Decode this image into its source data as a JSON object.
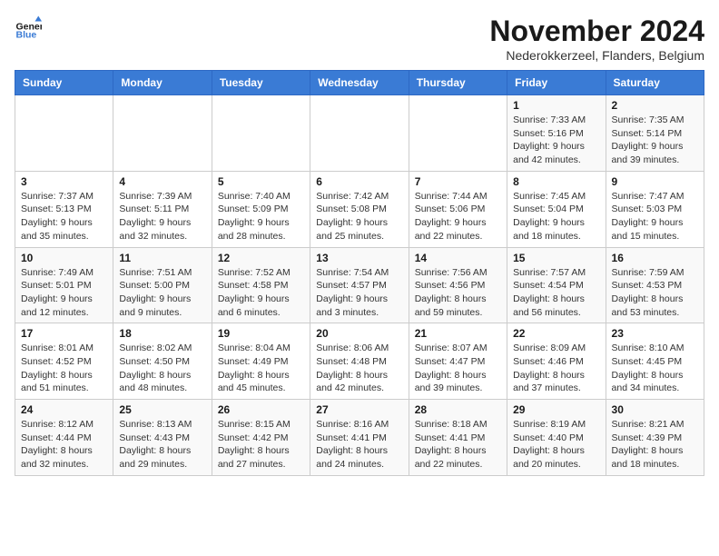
{
  "logo": {
    "text_general": "General",
    "text_blue": "Blue"
  },
  "header": {
    "month_year": "November 2024",
    "location": "Nederokkerzeel, Flanders, Belgium"
  },
  "days_of_week": [
    "Sunday",
    "Monday",
    "Tuesday",
    "Wednesday",
    "Thursday",
    "Friday",
    "Saturday"
  ],
  "weeks": [
    [
      {
        "day": "",
        "info": ""
      },
      {
        "day": "",
        "info": ""
      },
      {
        "day": "",
        "info": ""
      },
      {
        "day": "",
        "info": ""
      },
      {
        "day": "",
        "info": ""
      },
      {
        "day": "1",
        "info": "Sunrise: 7:33 AM\nSunset: 5:16 PM\nDaylight: 9 hours and 42 minutes."
      },
      {
        "day": "2",
        "info": "Sunrise: 7:35 AM\nSunset: 5:14 PM\nDaylight: 9 hours and 39 minutes."
      }
    ],
    [
      {
        "day": "3",
        "info": "Sunrise: 7:37 AM\nSunset: 5:13 PM\nDaylight: 9 hours and 35 minutes."
      },
      {
        "day": "4",
        "info": "Sunrise: 7:39 AM\nSunset: 5:11 PM\nDaylight: 9 hours and 32 minutes."
      },
      {
        "day": "5",
        "info": "Sunrise: 7:40 AM\nSunset: 5:09 PM\nDaylight: 9 hours and 28 minutes."
      },
      {
        "day": "6",
        "info": "Sunrise: 7:42 AM\nSunset: 5:08 PM\nDaylight: 9 hours and 25 minutes."
      },
      {
        "day": "7",
        "info": "Sunrise: 7:44 AM\nSunset: 5:06 PM\nDaylight: 9 hours and 22 minutes."
      },
      {
        "day": "8",
        "info": "Sunrise: 7:45 AM\nSunset: 5:04 PM\nDaylight: 9 hours and 18 minutes."
      },
      {
        "day": "9",
        "info": "Sunrise: 7:47 AM\nSunset: 5:03 PM\nDaylight: 9 hours and 15 minutes."
      }
    ],
    [
      {
        "day": "10",
        "info": "Sunrise: 7:49 AM\nSunset: 5:01 PM\nDaylight: 9 hours and 12 minutes."
      },
      {
        "day": "11",
        "info": "Sunrise: 7:51 AM\nSunset: 5:00 PM\nDaylight: 9 hours and 9 minutes."
      },
      {
        "day": "12",
        "info": "Sunrise: 7:52 AM\nSunset: 4:58 PM\nDaylight: 9 hours and 6 minutes."
      },
      {
        "day": "13",
        "info": "Sunrise: 7:54 AM\nSunset: 4:57 PM\nDaylight: 9 hours and 3 minutes."
      },
      {
        "day": "14",
        "info": "Sunrise: 7:56 AM\nSunset: 4:56 PM\nDaylight: 8 hours and 59 minutes."
      },
      {
        "day": "15",
        "info": "Sunrise: 7:57 AM\nSunset: 4:54 PM\nDaylight: 8 hours and 56 minutes."
      },
      {
        "day": "16",
        "info": "Sunrise: 7:59 AM\nSunset: 4:53 PM\nDaylight: 8 hours and 53 minutes."
      }
    ],
    [
      {
        "day": "17",
        "info": "Sunrise: 8:01 AM\nSunset: 4:52 PM\nDaylight: 8 hours and 51 minutes."
      },
      {
        "day": "18",
        "info": "Sunrise: 8:02 AM\nSunset: 4:50 PM\nDaylight: 8 hours and 48 minutes."
      },
      {
        "day": "19",
        "info": "Sunrise: 8:04 AM\nSunset: 4:49 PM\nDaylight: 8 hours and 45 minutes."
      },
      {
        "day": "20",
        "info": "Sunrise: 8:06 AM\nSunset: 4:48 PM\nDaylight: 8 hours and 42 minutes."
      },
      {
        "day": "21",
        "info": "Sunrise: 8:07 AM\nSunset: 4:47 PM\nDaylight: 8 hours and 39 minutes."
      },
      {
        "day": "22",
        "info": "Sunrise: 8:09 AM\nSunset: 4:46 PM\nDaylight: 8 hours and 37 minutes."
      },
      {
        "day": "23",
        "info": "Sunrise: 8:10 AM\nSunset: 4:45 PM\nDaylight: 8 hours and 34 minutes."
      }
    ],
    [
      {
        "day": "24",
        "info": "Sunrise: 8:12 AM\nSunset: 4:44 PM\nDaylight: 8 hours and 32 minutes."
      },
      {
        "day": "25",
        "info": "Sunrise: 8:13 AM\nSunset: 4:43 PM\nDaylight: 8 hours and 29 minutes."
      },
      {
        "day": "26",
        "info": "Sunrise: 8:15 AM\nSunset: 4:42 PM\nDaylight: 8 hours and 27 minutes."
      },
      {
        "day": "27",
        "info": "Sunrise: 8:16 AM\nSunset: 4:41 PM\nDaylight: 8 hours and 24 minutes."
      },
      {
        "day": "28",
        "info": "Sunrise: 8:18 AM\nSunset: 4:41 PM\nDaylight: 8 hours and 22 minutes."
      },
      {
        "day": "29",
        "info": "Sunrise: 8:19 AM\nSunset: 4:40 PM\nDaylight: 8 hours and 20 minutes."
      },
      {
        "day": "30",
        "info": "Sunrise: 8:21 AM\nSunset: 4:39 PM\nDaylight: 8 hours and 18 minutes."
      }
    ]
  ]
}
